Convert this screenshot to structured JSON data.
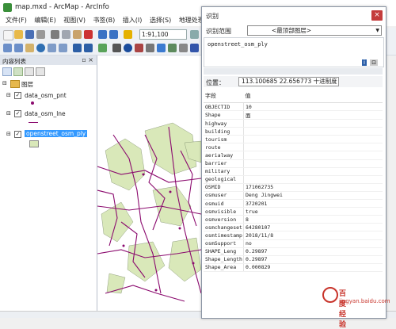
{
  "window": {
    "title": "map.mxd - ArcMap - ArcInfo"
  },
  "menu": [
    "文件(F)",
    "编辑(E)",
    "视图(V)",
    "书签(B)",
    "插入(I)",
    "选择(S)",
    "地理处理(G)"
  ],
  "toolbar": {
    "scale_value": "1:91,100"
  },
  "toc": {
    "title": "内容列表",
    "root_label": "图层",
    "layers": [
      {
        "name": "data_osm_pnt",
        "checked": true,
        "selected": false
      },
      {
        "name": "data_osm_lne",
        "checked": true,
        "selected": false
      },
      {
        "name": "openstreet_osm_ply",
        "checked": true,
        "selected": true
      }
    ]
  },
  "identify": {
    "title": "识别",
    "close_glyph": "×",
    "range_label": "识别范围",
    "range_value": "<最顶部图层>",
    "tree_item": "openstreet_osm_ply",
    "location_label": "位置：",
    "location_value": "113.100685  22.656773 十进制度",
    "columns": {
      "field": "字段",
      "value": "值"
    },
    "rows": [
      {
        "field": "OBJECTID",
        "value": "10"
      },
      {
        "field": "Shape",
        "value": "面"
      },
      {
        "field": "highway",
        "value": ""
      },
      {
        "field": "building",
        "value": ""
      },
      {
        "field": "tourism",
        "value": ""
      },
      {
        "field": "route",
        "value": ""
      },
      {
        "field": "aerialway",
        "value": ""
      },
      {
        "field": "barrier",
        "value": ""
      },
      {
        "field": "military",
        "value": ""
      },
      {
        "field": "geological",
        "value": ""
      },
      {
        "field": "OSMID",
        "value": "171062735"
      },
      {
        "field": "osmuser",
        "value": "Deng Jingwei"
      },
      {
        "field": "osmuid",
        "value": "3720201"
      },
      {
        "field": "osmvisible",
        "value": "true"
      },
      {
        "field": "osmversion",
        "value": "8"
      },
      {
        "field": "osmchangeset",
        "value": "64280107"
      },
      {
        "field": "osmtimestamp",
        "value": "2018/11/8"
      },
      {
        "field": "osmSupport",
        "value": "no"
      },
      {
        "field": "SHAPE_Leng",
        "value": "0.29897"
      },
      {
        "field": "Shape_Length",
        "value": "0.29897"
      },
      {
        "field": "Shape_Area",
        "value": "0.000829"
      }
    ]
  },
  "watermark": {
    "brand": "百度经验",
    "url": "jingyan.baidu.com"
  },
  "colors": {
    "feature_magenta": "#8b0a6e",
    "polygon_fill": "#d9e8b9",
    "selection": "#3399ff"
  }
}
